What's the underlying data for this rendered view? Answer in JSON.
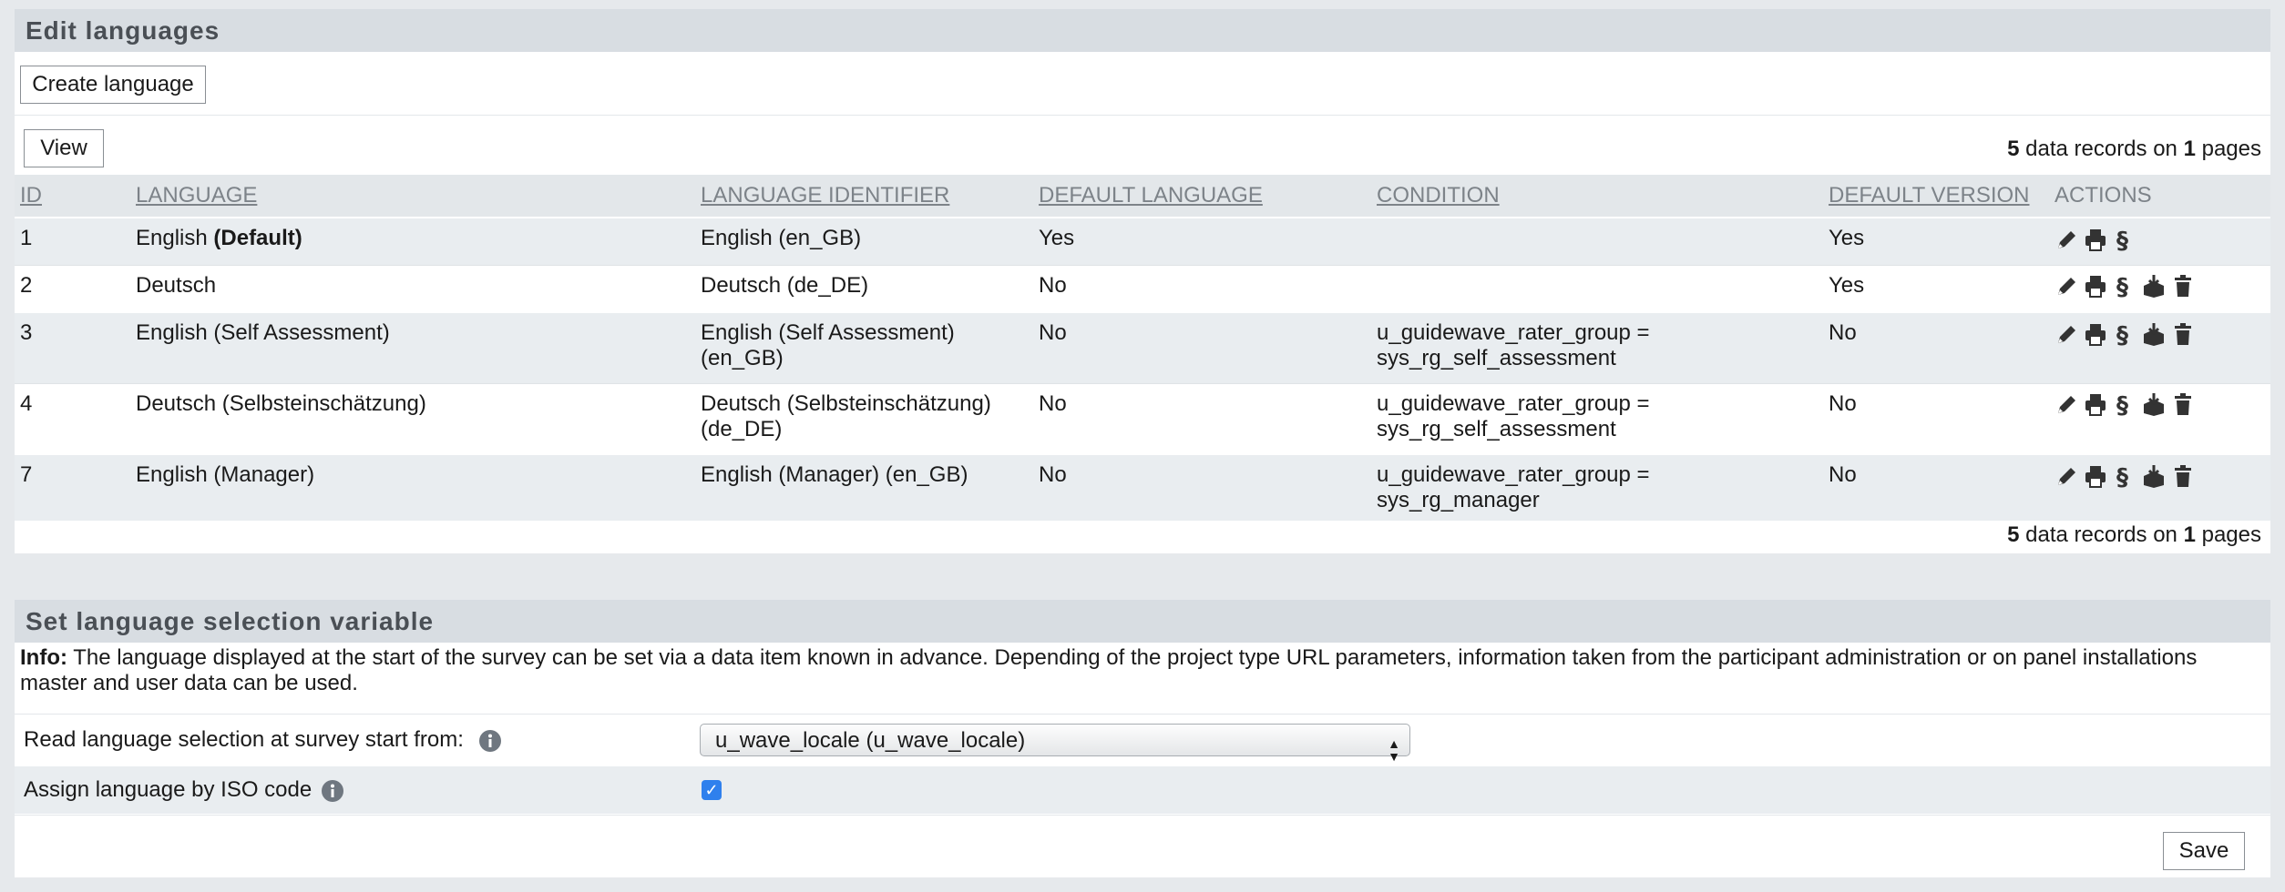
{
  "edit_panel": {
    "title": "Edit languages",
    "create_button": "Create language",
    "view_button": "View",
    "records_count": "5",
    "records_mid": "data records on",
    "records_pages": "1",
    "records_end": "pages",
    "columns": {
      "id": "ID",
      "language": "LANGUAGE",
      "identifier": "LANGUAGE IDENTIFIER",
      "default_language": "DEFAULT LANGUAGE",
      "condition": "CONDITION",
      "default_version": "DEFAULT VERSION",
      "actions": "ACTIONS"
    },
    "rows": [
      {
        "id": "1",
        "language": "English",
        "language_suffix": "(Default)",
        "identifier": "English (en_GB)",
        "default_language": "Yes",
        "condition": "",
        "default_version": "Yes"
      },
      {
        "id": "2",
        "language": "Deutsch",
        "language_suffix": "",
        "identifier": "Deutsch (de_DE)",
        "default_language": "No",
        "condition": "",
        "default_version": "Yes"
      },
      {
        "id": "3",
        "language": "English (Self Assessment)",
        "language_suffix": "",
        "identifier": "English (Self Assessment) (en_GB)",
        "default_language": "No",
        "condition": "u_guidewave_rater_group = sys_rg_self_assessment",
        "default_version": "No"
      },
      {
        "id": "4",
        "language": "Deutsch (Selbsteinschätzung)",
        "language_suffix": "",
        "identifier": "Deutsch (Selbsteinschätzung) (de_DE)",
        "default_language": "No",
        "condition": "u_guidewave_rater_group = sys_rg_self_assessment",
        "default_version": "No"
      },
      {
        "id": "7",
        "language": "English (Manager)",
        "language_suffix": "",
        "identifier": "English (Manager) (en_GB)",
        "default_language": "No",
        "condition": "u_guidewave_rater_group = sys_rg_manager",
        "default_version": "No"
      }
    ],
    "icons": {
      "edit": "pencil-icon",
      "print": "print-icon",
      "paragraph": "paragraph-icon",
      "export": "export-box-icon",
      "delete": "trash-icon"
    }
  },
  "selection_panel": {
    "title": "Set language selection variable",
    "info_label": "Info:",
    "info_text": "The language displayed at the start of the survey can be set via a data item known in advance. Depending of the project type URL parameters, information taken from the participant administration or on panel installations master and user data can be used.",
    "read_label": "Read language selection at survey start from:",
    "read_value": "u_wave_locale (u_wave_locale)",
    "iso_label": "Assign language by ISO code",
    "iso_checked": true,
    "save_button": "Save"
  },
  "colors": {
    "header_bg": "#d8dde2",
    "row_shade": "#e9edf0",
    "checkbox": "#2f80ed",
    "info_icon": "#6f7780"
  }
}
